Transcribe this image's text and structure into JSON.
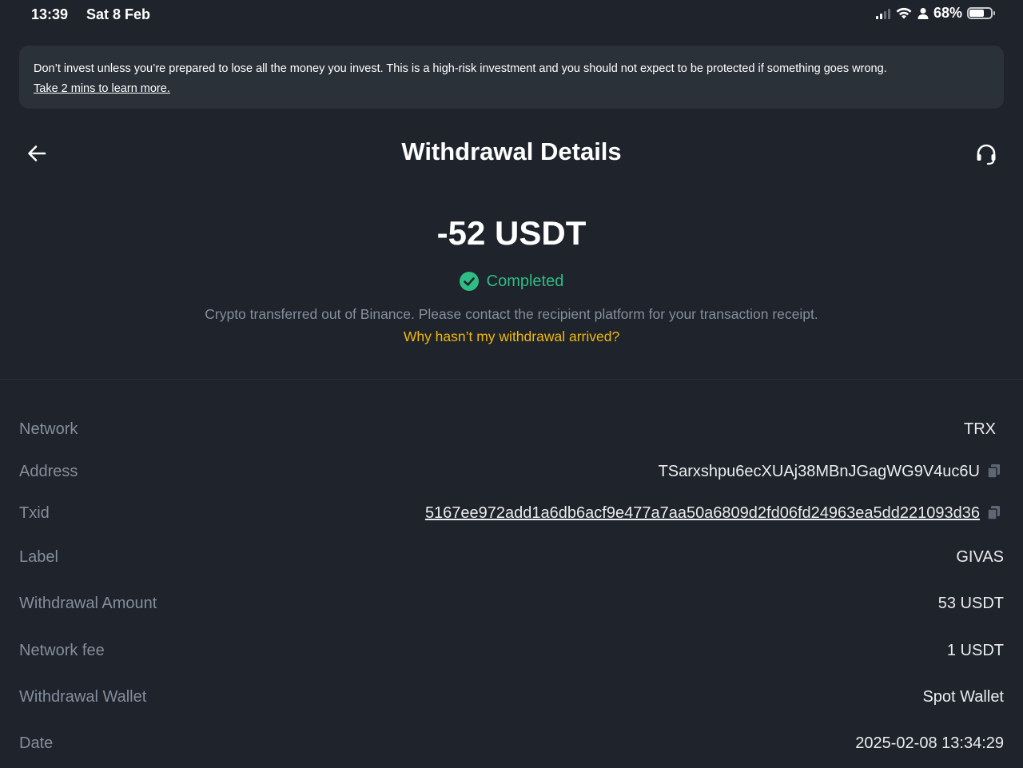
{
  "status_bar": {
    "time": "13:39",
    "date": "Sat 8 Feb",
    "battery": "68%"
  },
  "banner": {
    "text": "Don’t invest unless you’re prepared to lose all the money you invest. This is a high-risk investment and you should not expect to be protected if something goes wrong.",
    "link": "Take 2 mins to learn more."
  },
  "header": {
    "title": "Withdrawal Details",
    "back_icon": "arrow-left-icon",
    "support_icon": "headset-icon"
  },
  "summary": {
    "amount": "-52 USDT",
    "status": "Completed",
    "status_color": "#2ebd85",
    "note": "Crypto transferred out of Binance. Please contact the recipient platform for your transaction receipt.",
    "help_link": "Why hasn’t my withdrawal arrived?",
    "help_link_color": "#f0b90b"
  },
  "details": {
    "network": {
      "label": "Network",
      "value": "TRX"
    },
    "address": {
      "label": "Address",
      "value": "TSarxshpu6ecXUAj38MBnJGagWG9V4uc6U"
    },
    "txid": {
      "label": "Txid",
      "value": "5167ee972add1a6db6acf9e477a7aa50a6809d2fd06fd24963ea5dd221093d36"
    },
    "label": {
      "label": "Label",
      "value": "GIVAS"
    },
    "withdrawal_amount": {
      "label": "Withdrawal Amount",
      "value": "53 USDT"
    },
    "network_fee": {
      "label": "Network fee",
      "value": "1 USDT"
    },
    "withdrawal_wallet": {
      "label": "Withdrawal Wallet",
      "value": "Spot Wallet"
    },
    "date": {
      "label": "Date",
      "value": "2025-02-08 13:34:29"
    }
  }
}
